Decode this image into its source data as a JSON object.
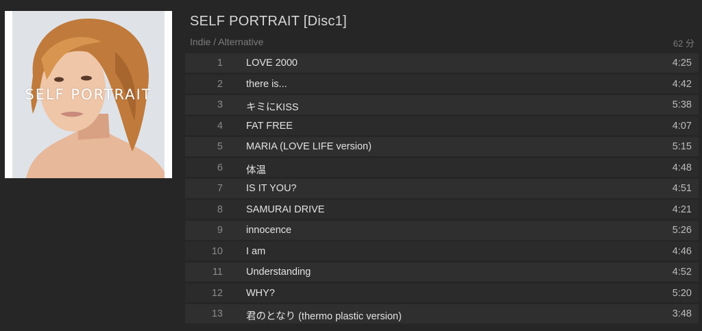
{
  "album": {
    "title": "SELF PORTRAIT [Disc1]",
    "genre": "Indie / Alternative",
    "duration": "62 分",
    "cover_text": "SELF PORTRAIT"
  },
  "tracks": [
    {
      "num": "1",
      "title": "LOVE 2000",
      "time": "4:25"
    },
    {
      "num": "2",
      "title": "there is...",
      "time": "4:42"
    },
    {
      "num": "3",
      "title": "キミにKISS",
      "time": "5:38"
    },
    {
      "num": "4",
      "title": "FAT FREE",
      "time": "4:07"
    },
    {
      "num": "5",
      "title": "MARIA (LOVE LIFE version)",
      "time": "5:15"
    },
    {
      "num": "6",
      "title": "体温",
      "time": "4:48"
    },
    {
      "num": "7",
      "title": "IS IT YOU?",
      "time": "4:51"
    },
    {
      "num": "8",
      "title": "SAMURAI DRIVE",
      "time": "4:21"
    },
    {
      "num": "9",
      "title": "innocence",
      "time": "5:26"
    },
    {
      "num": "10",
      "title": "I am",
      "time": "4:46"
    },
    {
      "num": "11",
      "title": "Understanding",
      "time": "4:52"
    },
    {
      "num": "12",
      "title": "WHY?",
      "time": "5:20"
    },
    {
      "num": "13",
      "title": "君のとなり (thermo plastic version)",
      "time": "3:48"
    }
  ]
}
